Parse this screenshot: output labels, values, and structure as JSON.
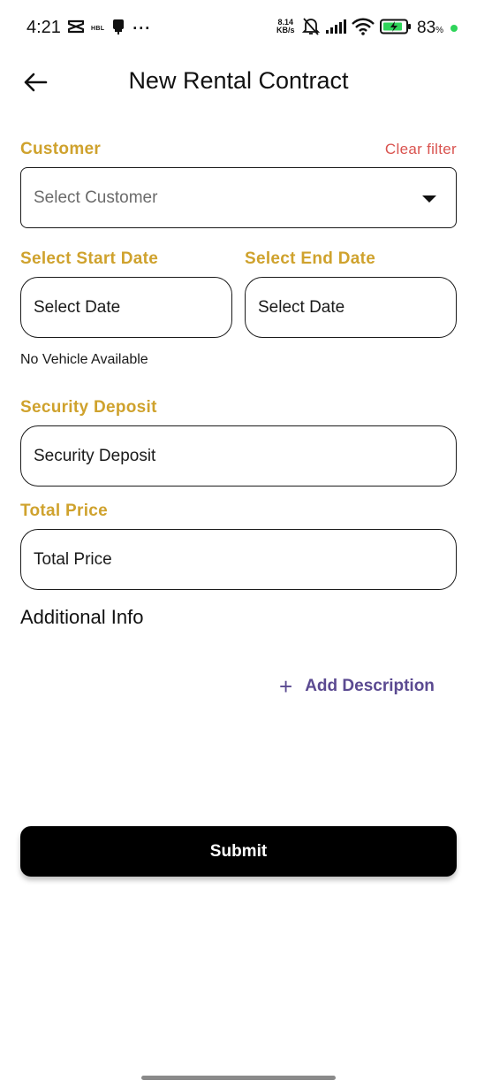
{
  "status_bar": {
    "time": "4:21",
    "carrier_badge": "HBL",
    "more": "···",
    "speed_value": "8.14",
    "speed_unit": "KB/s",
    "battery_percent": "83",
    "percent_sign": "%",
    "accent_dot_color": "#2fd45a"
  },
  "header": {
    "title": "New Rental Contract",
    "back_icon": "arrow-left-icon"
  },
  "customer": {
    "label": "Customer",
    "clear_label": "Clear filter",
    "placeholder": "Select Customer"
  },
  "dates": {
    "start_label": "Select Start Date",
    "start_placeholder": "Select Date",
    "end_label": "Select End Date",
    "end_placeholder": "Select Date"
  },
  "vehicle_note": "No Vehicle Available",
  "deposit": {
    "label": "Security Deposit",
    "placeholder": "Security Deposit"
  },
  "price": {
    "label": "Total Price",
    "placeholder": "Total Price"
  },
  "additional": {
    "title": "Additional Info",
    "add_label": "Add Description"
  },
  "submit_label": "Submit",
  "colors": {
    "label_gold": "#cfa22d",
    "clear_red": "#d9534f",
    "add_purple": "#5b4a91",
    "submit_bg": "#000000"
  }
}
